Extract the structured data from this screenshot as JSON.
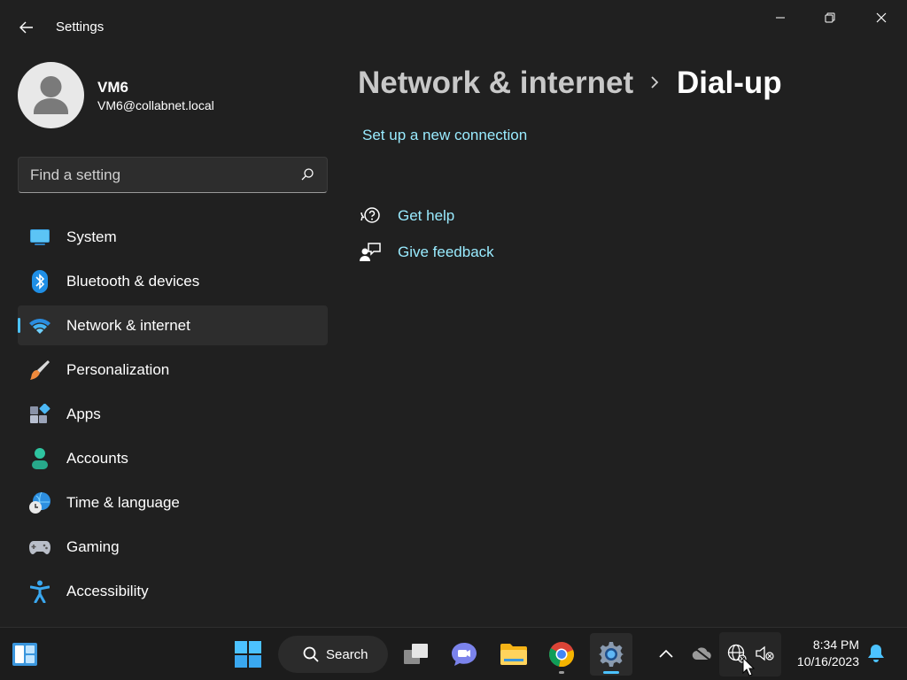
{
  "window": {
    "title": "Settings"
  },
  "profile": {
    "name": "VM6",
    "email": "VM6@collabnet.local"
  },
  "search": {
    "placeholder": "Find a setting",
    "value": ""
  },
  "nav": {
    "items": [
      {
        "label": "System",
        "icon": "system-icon",
        "selected": false
      },
      {
        "label": "Bluetooth & devices",
        "icon": "bluetooth-icon",
        "selected": false
      },
      {
        "label": "Network & internet",
        "icon": "wifi-icon",
        "selected": true
      },
      {
        "label": "Personalization",
        "icon": "brush-icon",
        "selected": false
      },
      {
        "label": "Apps",
        "icon": "apps-icon",
        "selected": false
      },
      {
        "label": "Accounts",
        "icon": "accounts-icon",
        "selected": false
      },
      {
        "label": "Time & language",
        "icon": "globe-clock-icon",
        "selected": false
      },
      {
        "label": "Gaming",
        "icon": "gamepad-icon",
        "selected": false
      },
      {
        "label": "Accessibility",
        "icon": "accessibility-icon",
        "selected": false
      }
    ]
  },
  "main": {
    "breadcrumb_parent": "Network & internet",
    "breadcrumb_current": "Dial-up",
    "setup_link": "Set up a new connection",
    "get_help": "Get help",
    "give_feedback": "Give feedback"
  },
  "taskbar": {
    "search_label": "Search",
    "time": "8:34 PM",
    "date": "10/16/2023"
  },
  "colors": {
    "accent": "#4cc2ff",
    "link": "#99ebff",
    "background": "#202020"
  }
}
